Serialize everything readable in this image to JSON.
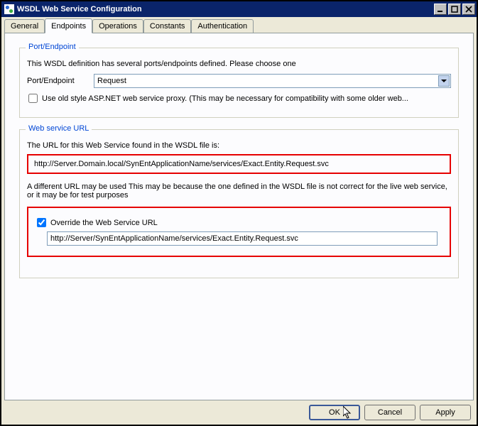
{
  "window": {
    "title": "WSDL Web Service Configuration"
  },
  "tabs": {
    "general": "General",
    "endpoints": "Endpoints",
    "operations": "Operations",
    "constants": "Constants",
    "authentication": "Authentication",
    "active": "endpoints"
  },
  "port_endpoint_group": {
    "legend": "Port/Endpoint",
    "intro": "This WSDL definition has several ports/endpoints defined. Please choose one",
    "label": "Port/Endpoint",
    "selected": "Request",
    "old_style_checked": false,
    "old_style_label": "Use old style ASP.NET web service proxy.  (This may be necessary for compatibility with some older web..."
  },
  "web_service_url_group": {
    "legend": "Web service URL",
    "found_text": "The URL for this Web Service found in the WSDL file is:",
    "found_url": "http://Server.Domain.local/SynEntApplicationName/services/Exact.Entity.Request.svc",
    "diff_text": "A different URL may be used This may be because the one defined in the WSDL file is not correct for the live web service, or it may be for test purposes",
    "override_checked": true,
    "override_label": "Override the Web Service URL",
    "override_value": "http://Server/SynEntApplicationName/services/Exact.Entity.Request.svc"
  },
  "buttons": {
    "ok": "OK",
    "cancel": "Cancel",
    "apply": "Apply"
  }
}
